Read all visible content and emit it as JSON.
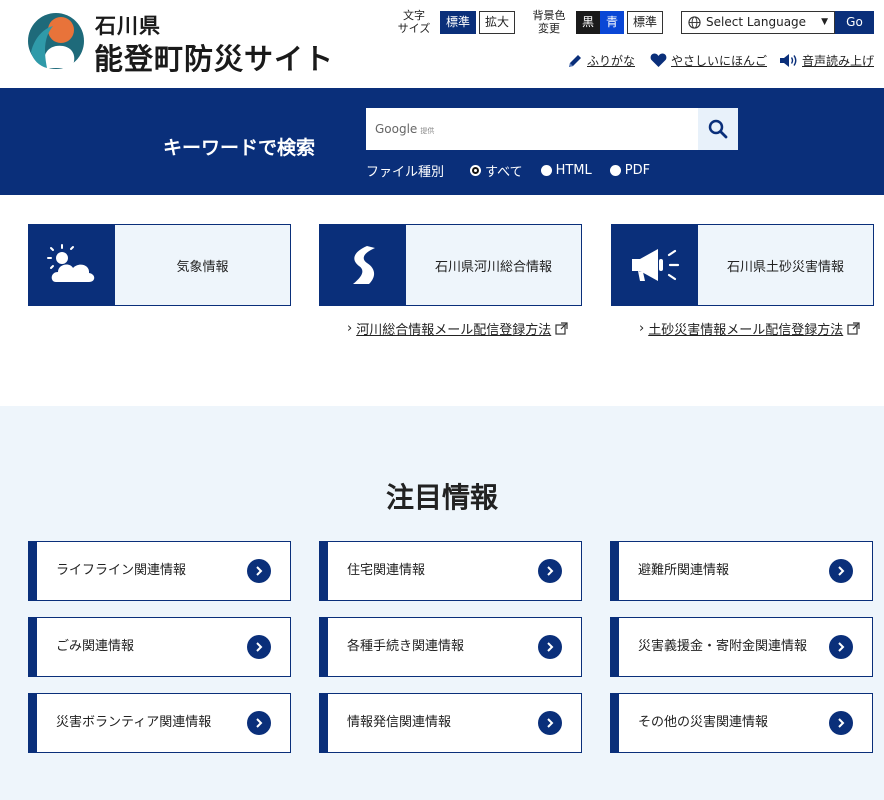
{
  "header": {
    "pref": "石川県",
    "site_title": "能登町防災サイト",
    "font_size_label": "文字\nサイズ",
    "font_size_standard": "標準",
    "font_size_large": "拡大",
    "bg_label": "背景色\n変更",
    "bg_black": "黒",
    "bg_blue": "青",
    "bg_standard": "標準",
    "language_select": "Select Language",
    "go": "Go",
    "furigana": "ふりがな",
    "easy_japanese": "やさしいにほんご",
    "read_aloud": "音声読み上げ"
  },
  "search": {
    "heading": "キーワードで検索",
    "google_brand": "Google",
    "google_provided": "提供",
    "filetype_label": "ファイル種別",
    "options": [
      "すべて",
      "HTML",
      "PDF"
    ],
    "selected": "すべて"
  },
  "info_cards": [
    {
      "label": "気象情報",
      "icon": "weather-icon"
    },
    {
      "label": "石川県河川総合情報",
      "icon": "river-icon"
    },
    {
      "label": "石川県土砂災害情報",
      "icon": "megaphone-icon"
    }
  ],
  "sub_links": [
    "河川総合情報メール配信登録方法",
    "土砂災害情報メール配信登録方法"
  ],
  "featured": {
    "title": "注目情報",
    "items": [
      "ライフライン関連情報",
      "住宅関連情報",
      "避難所関連情報",
      "ごみ関連情報",
      "各種手続き関連情報",
      "災害義援金・寄附金関連情報",
      "災害ボランティア関連情報",
      "情報発信関連情報",
      "その他の災害関連情報"
    ]
  },
  "colors": {
    "primary": "#0a2f7a",
    "light_bg": "#eef5fb",
    "logo_orange": "#e8733a",
    "logo_teal": "#1e6a7a"
  }
}
